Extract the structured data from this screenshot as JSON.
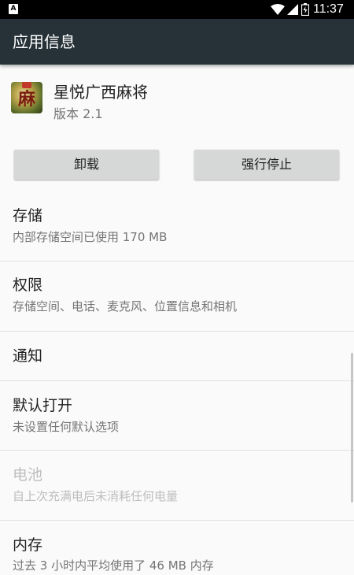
{
  "status_bar": {
    "left_icon": "A",
    "time": "11:37",
    "icons": [
      "a-icon",
      "wifi-icon",
      "signal-icon",
      "battery-icon"
    ]
  },
  "app_bar": {
    "title": "应用信息"
  },
  "app": {
    "name": "星悦广西麻将",
    "version": "版本 2.1",
    "icon_glyph": "麻"
  },
  "buttons": {
    "uninstall": "卸载",
    "force_stop": "强行停止"
  },
  "rows": [
    {
      "title": "存储",
      "subtitle": "内部存储空间已使用 170 MB"
    },
    {
      "title": "权限",
      "subtitle": "存储空间、电话、麦克风、位置信息和相机"
    },
    {
      "title": "通知"
    },
    {
      "title": "默认打开",
      "subtitle": "未设置任何默认选项"
    },
    {
      "title": "电池",
      "subtitle": "自上次充满电后未消耗任何电量"
    },
    {
      "title": "内存",
      "subtitle": "过去 3 小时内平均使用了 46 MB 内存"
    }
  ],
  "colors": {
    "app_bar": "#263238",
    "status_bar": "#000000",
    "button": "#d6d7d7",
    "background": "#fafafa",
    "disabled_text": "#bdbdbd"
  }
}
